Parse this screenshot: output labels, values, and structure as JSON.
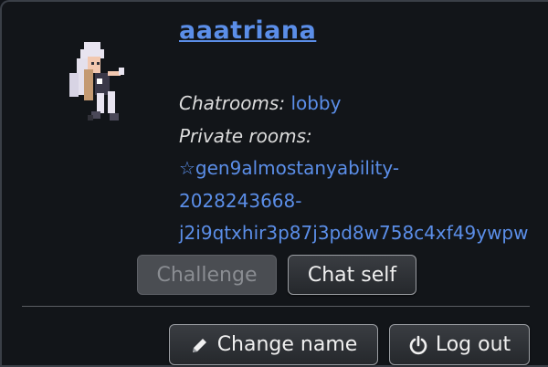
{
  "user": {
    "name": "aaatriana",
    "chatrooms_label": "Chatrooms:",
    "chatrooms_link": "lobby",
    "private_label": "Private rooms:",
    "private_line1": "☆gen9almostanyability-",
    "private_line2": "2028243668-",
    "private_line3": "j2i9qtxhir3p87j3pd8w758c4xf49ywpw"
  },
  "buttons": {
    "challenge": "Challenge",
    "chat_self": "Chat self",
    "change_name": "Change name",
    "log_out": "Log out"
  },
  "icons": {
    "change_name": "pencil-icon",
    "log_out": "power-icon"
  },
  "colors": {
    "link": "#5b8ee8",
    "background": "#121519"
  }
}
